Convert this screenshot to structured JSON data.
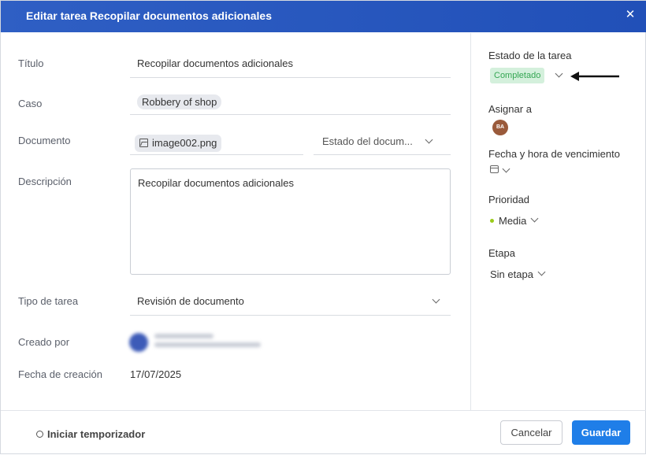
{
  "dialog": {
    "title": "Editar tarea Recopilar documentos adicionales",
    "close_icon": "close-icon"
  },
  "form": {
    "title_label": "Título",
    "title_value": "Recopilar documentos adicionales",
    "case_label": "Caso",
    "case_value": "Robbery of shop",
    "document_label": "Documento",
    "document_file": "image002.png",
    "document_status_placeholder": "Estado del docum...",
    "description_label": "Descripción",
    "description_value": "Recopilar documentos adicionales",
    "task_type_label": "Tipo de tarea",
    "task_type_value": "Revisión de documento",
    "created_by_label": "Creado por",
    "created_date_label": "Fecha de creación",
    "created_date_value": "17/07/2025"
  },
  "sidebar": {
    "status_label": "Estado de la tarea",
    "status_value": "Completado",
    "status_color": "#35a653",
    "assign_label": "Asignar a",
    "assignee_initials": "BA",
    "due_label": "Fecha y hora de vencimiento",
    "priority_label": "Prioridad",
    "priority_value": "Media",
    "priority_color": "#9acb1a",
    "stage_label": "Etapa",
    "stage_value": "Sin etapa"
  },
  "footer": {
    "timer_label": "Iniciar temporizador",
    "cancel_label": "Cancelar",
    "save_label": "Guardar",
    "save_color": "#1f7ee8"
  }
}
